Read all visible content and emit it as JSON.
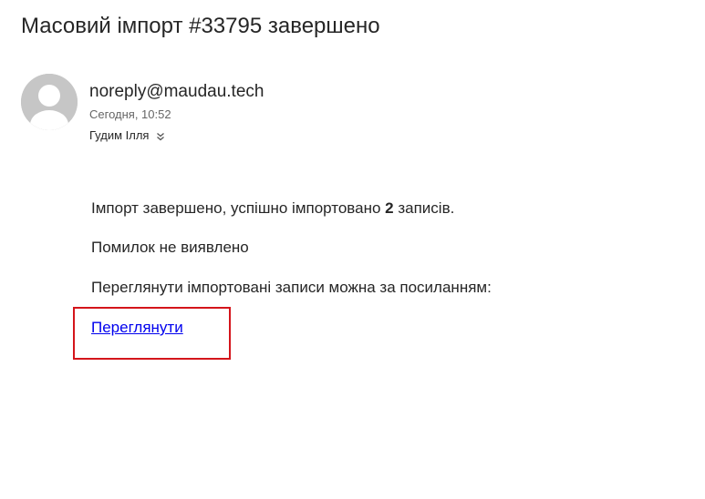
{
  "email": {
    "subject": "Масовий імпорт #33795 завершено",
    "sender": "noreply@maudau.tech",
    "datetime": "Сегодня, 10:52",
    "recipient": "Гудим Ілля",
    "recipient_expand_icon": "double-chevron-down-icon",
    "avatar_icon": "default-user-avatar-icon"
  },
  "body": {
    "line1_prefix": "Імпорт завершено, успішно імпортовано ",
    "line1_count": "2",
    "line1_suffix": " записів.",
    "line2": "Помилок не виявлено",
    "line3": "Переглянути імпортовані записи можна за посиланням:",
    "link_label": "Переглянути"
  },
  "colors": {
    "highlight_border": "#d4151b",
    "link": "#0000ee",
    "avatar_bg": "#c6c6c6"
  }
}
